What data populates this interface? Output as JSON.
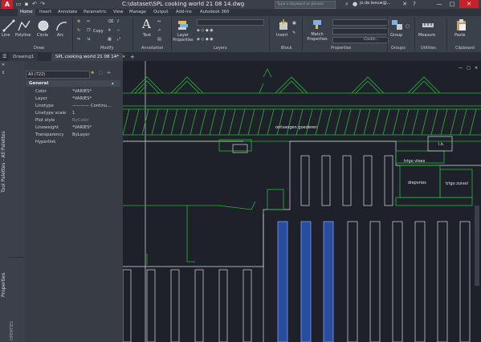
{
  "app": {
    "title": "C:\\dataset\\SPL cooking world 21 08 14.dwg",
    "logo": "A"
  },
  "titlebar": {
    "search_placeholder": "Type a keyword or phrase",
    "user": "jo.de.leeuw@...",
    "minimize": "—",
    "maximize": "□",
    "close": "✕"
  },
  "menu_tabs": [
    "Home",
    "Insert",
    "Annotate",
    "Parametric",
    "View",
    "Manage",
    "Output",
    "Add-ins",
    "Autodesk 360"
  ],
  "ribbon": {
    "draw": {
      "line": "Line",
      "polyline": "Polyline",
      "circle": "Circle",
      "arc": "Arc",
      "label": "Draw"
    },
    "modify": {
      "copy": "Copy",
      "label": "Modify"
    },
    "annotation": {
      "text": "Text",
      "label": "Annotation"
    },
    "layers": {
      "layer_properties": "Layer Properties",
      "label": "Layers"
    },
    "block": {
      "insert": "Insert",
      "label": "Block"
    },
    "properties": {
      "match": "Match Properties",
      "continuous": "Contin...",
      "label": "Properties"
    },
    "groups": {
      "group": "Group",
      "label": "Groups"
    },
    "utilities": {
      "measure": "Measure",
      "label": "Utilities"
    },
    "clipboard": {
      "paste": "Paste",
      "label": "Clipboard"
    }
  },
  "doc_tabs": [
    "Drawing1",
    "SPL cooking world 21 08 14*"
  ],
  "side_panels": {
    "tool_palette": "Tool Palettes - All Palettes",
    "properties": "Properties",
    "properties2": "OPERTIES"
  },
  "properties_palette": {
    "selection": "All (722)",
    "section": "General",
    "rows": [
      {
        "name": "Color",
        "value": "*VARIES*"
      },
      {
        "name": "Layer",
        "value": "*VARIES*"
      },
      {
        "name": "Linetype",
        "value": "———— Continu..."
      },
      {
        "name": "Linetype scale",
        "value": "1"
      },
      {
        "name": "Plot style",
        "value": "ByColor"
      },
      {
        "name": "Lineweight",
        "value": "*VARIES*"
      },
      {
        "name": "Transparency",
        "value": "ByLayer"
      },
      {
        "name": "Hyperlink",
        "value": ""
      }
    ]
  },
  "drawing_labels": {
    "corridor": "ontvangen   goederen",
    "trigo_vlees": "trigo vlees",
    "diepvries": "diepvries",
    "trigo_zuivel": "trigo zuivel",
    "small_room": "l.k."
  },
  "colors": {
    "accent": "#c4232c",
    "cad_green": "#2ab53a",
    "cad_white": "#d8dbe0",
    "selection_blue": "#6fa2ff",
    "background": "#1e2129"
  }
}
